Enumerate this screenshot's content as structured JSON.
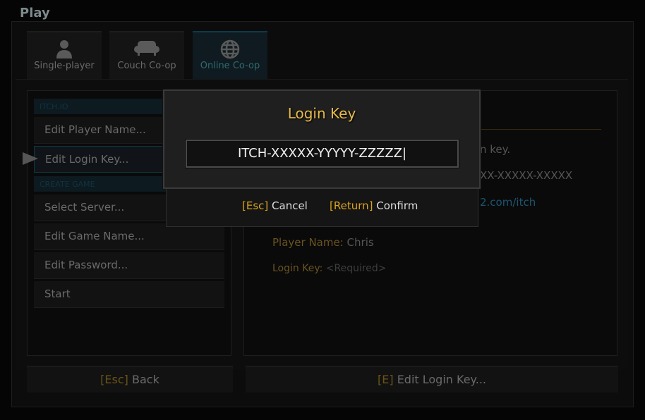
{
  "title": "Play",
  "tabs": [
    {
      "label": "Single-player",
      "icon": "person-icon"
    },
    {
      "label": "Couch Co-op",
      "icon": "couch-icon"
    },
    {
      "label": "Online Co-op",
      "icon": "globe-icon",
      "active": true
    }
  ],
  "menu": {
    "section1": "ITCH.IO",
    "edit_player_name": "Edit Player Name...",
    "edit_login_key": "Edit Login Key...",
    "section2": "CREATE GAME",
    "select_server": "Select Server...",
    "edit_game_name": "Edit Game Name...",
    "edit_password": "Edit Password...",
    "start": "Start"
  },
  "info": {
    "line1_fragment": "n key.",
    "line2_fragment": "XX-XXXXX-XXXXX",
    "link_fragment": "2.com/itch",
    "player_name_label": "Player Name:",
    "player_name_value": "Chris",
    "login_key_label": "Login Key:",
    "login_key_value": "<Required>"
  },
  "buttons": {
    "back_key": "[Esc]",
    "back": "Back",
    "edit_key": "[E]",
    "edit": "Edit Login Key..."
  },
  "dialog": {
    "title": "Login Key",
    "value": "ITCH-XXXXX-YYYYY-ZZZZZ|",
    "cancel_key": "[Esc]",
    "cancel": "Cancel",
    "confirm_key": "[Return]",
    "confirm": "Confirm"
  },
  "colors": {
    "accent_gold": "#e8b94a",
    "key_gold": "#d9a41e",
    "active_tab": "#2f6b6f",
    "link": "#1d5670"
  }
}
